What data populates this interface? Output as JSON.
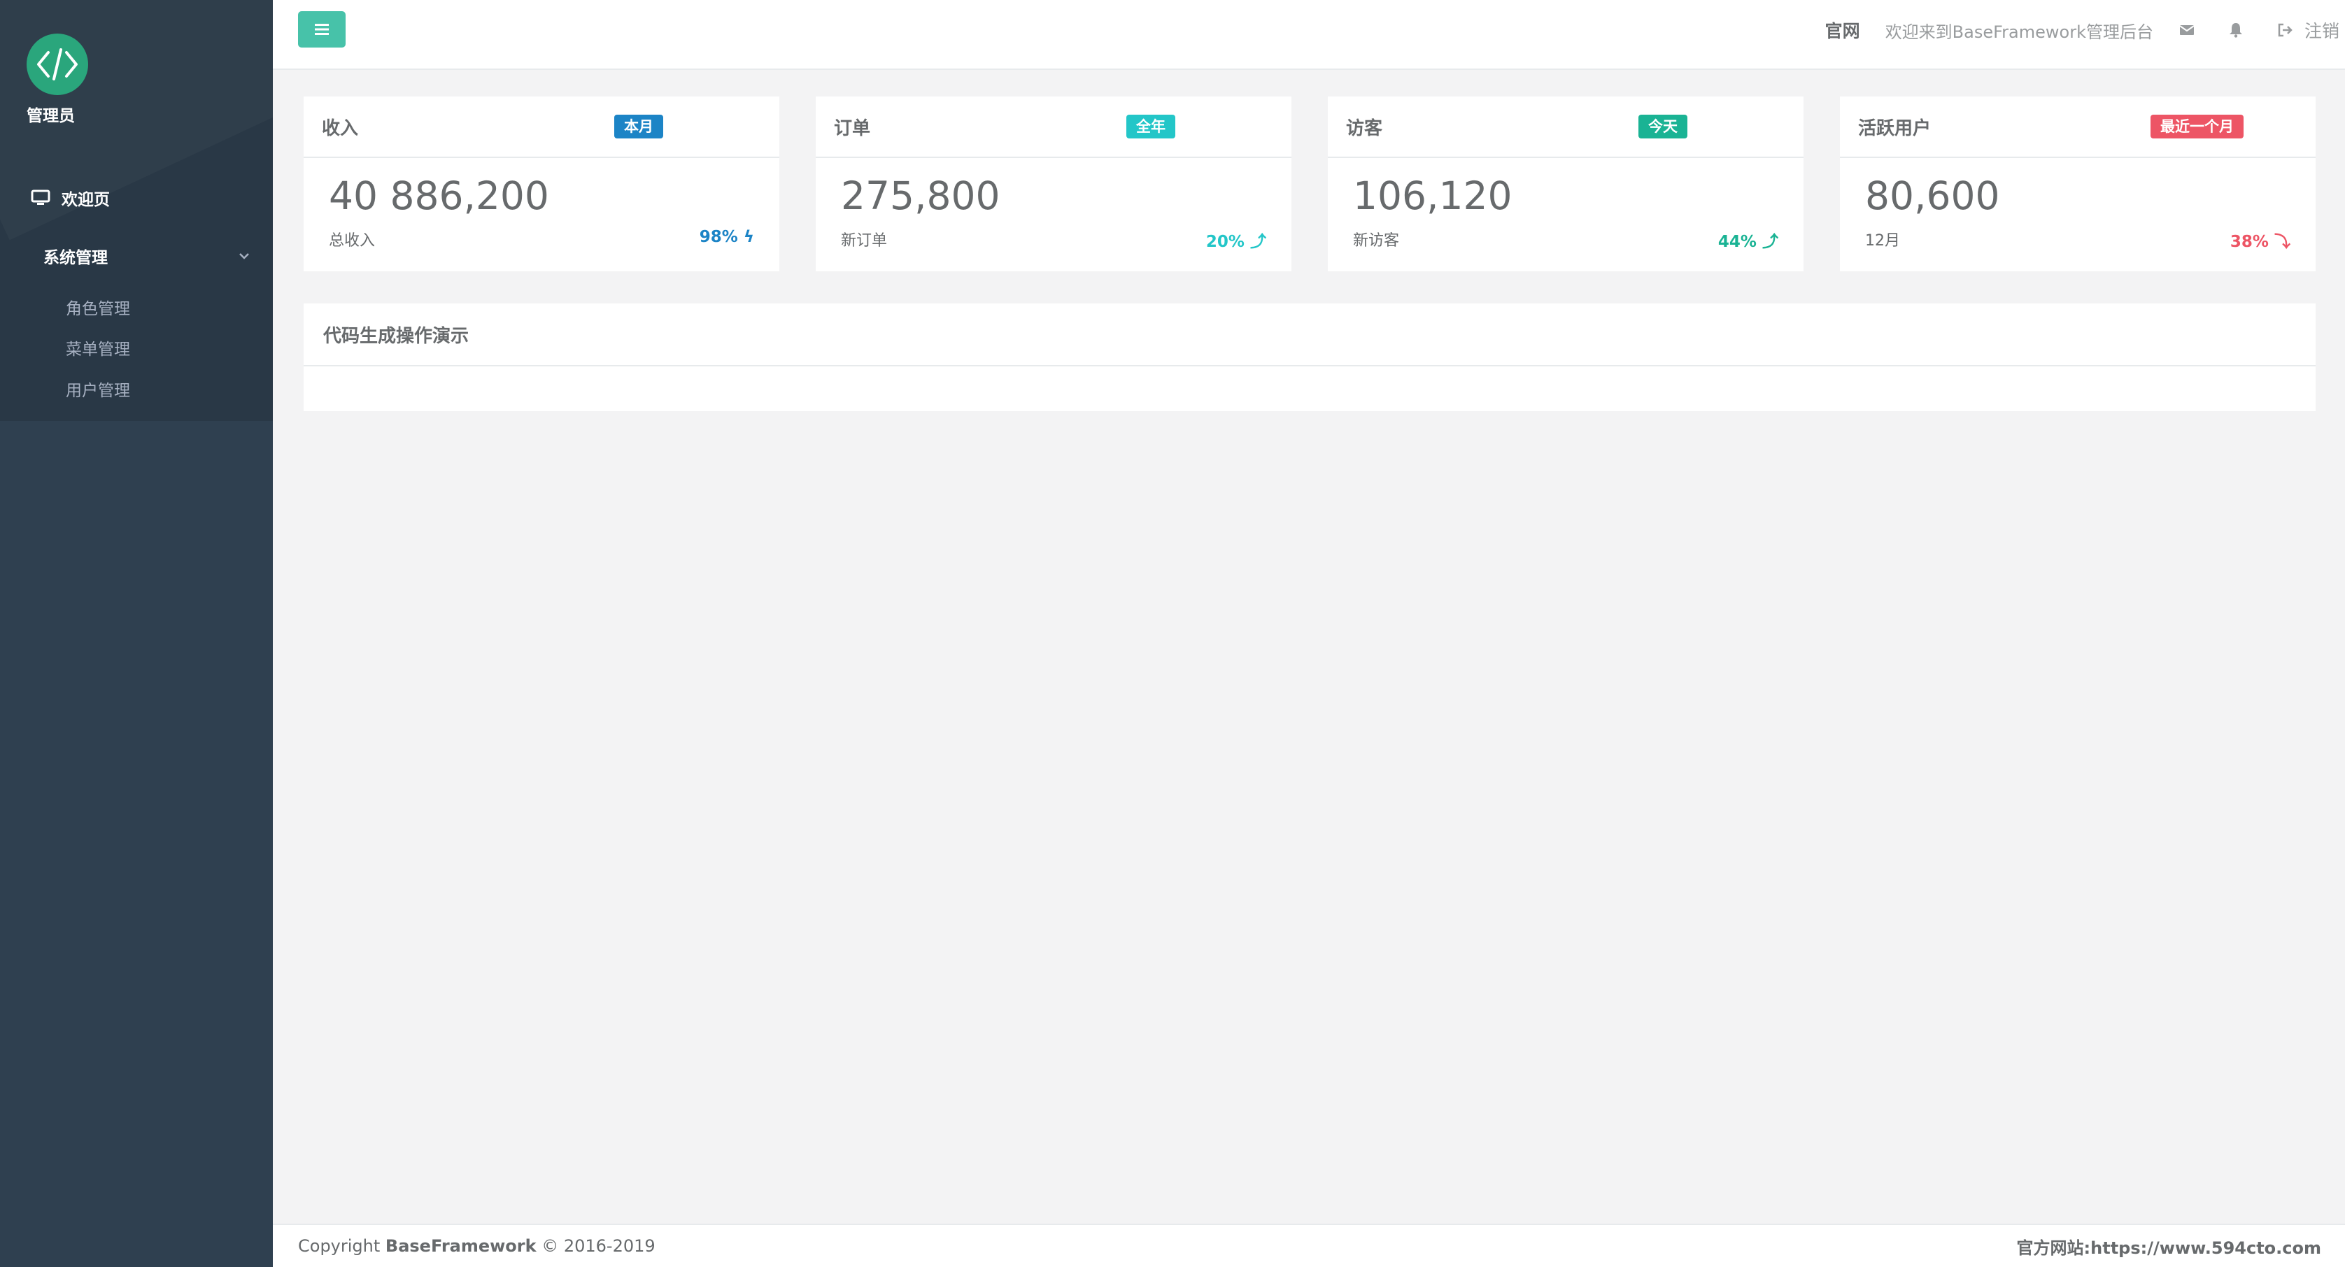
{
  "sidebar": {
    "admin_name": "管理员",
    "nav_welcome": "欢迎页",
    "nav_system": "系统管理",
    "sub_items": [
      {
        "label": "角色管理"
      },
      {
        "label": "菜单管理"
      },
      {
        "label": "用户管理"
      }
    ]
  },
  "topbar": {
    "official_link": "官网",
    "welcome_text": "欢迎来到BaseFramework管理后台",
    "logout": "注销"
  },
  "cards": [
    {
      "title": "收入",
      "badge": "本月",
      "badge_color": "#1c84c6",
      "value": "40 886,200",
      "label": "总收入",
      "pct": "98%",
      "pct_icon": "ϟ",
      "pct_color": "#1c84c6"
    },
    {
      "title": "订单",
      "badge": "全年",
      "badge_color": "#23c6c8",
      "value": "275,800",
      "label": "新订单",
      "pct": "20%",
      "pct_icon": "⤴",
      "pct_color": "#23c6c8"
    },
    {
      "title": "访客",
      "badge": "今天",
      "badge_color": "#1ab394",
      "value": "106,120",
      "label": "新访客",
      "pct": "44%",
      "pct_icon": "⤴",
      "pct_color": "#1ab394"
    },
    {
      "title": "活跃用户",
      "badge": "最近一个月",
      "badge_color": "#ed5565",
      "value": "80,600",
      "label": "12月",
      "pct": "38%",
      "pct_icon": "⤵",
      "pct_color": "#ed5565"
    }
  ],
  "panel": {
    "title": "代码生成操作演示"
  },
  "footer": {
    "copyright_prefix": "Copyright ",
    "brand": "BaseFramework",
    "copyright_suffix": " © 2016-2019",
    "site": "官方网站:https://www.594cto.com"
  }
}
